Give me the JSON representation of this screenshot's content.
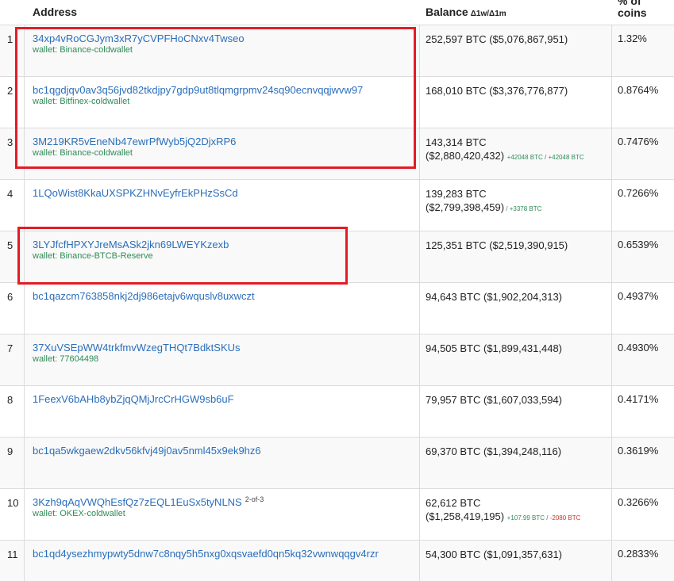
{
  "header": {
    "address": "Address",
    "balance": "Balance",
    "balance_sub": "Δ1w/Δ1m",
    "pct_line1": "% of",
    "pct_line2": "coins"
  },
  "rows": [
    {
      "rank": "1",
      "address": "34xp4vRoCGJym3xR7yCVPFHoCNxv4Twseo",
      "wallet": "wallet: Binance-coldwallet",
      "balance": "252,597 BTC ($5,076,867,951)",
      "pct": "1.32%"
    },
    {
      "rank": "2",
      "address": "bc1qgdjqv0av3q56jvd82tkdjpy7gdp9ut8tlqmgrpmv24sq90ecnvqqjwvw97",
      "wallet": "wallet: Bitfinex-coldwallet",
      "balance": "168,010 BTC ($3,376,776,877)",
      "pct": "0.8764%"
    },
    {
      "rank": "3",
      "address": "3M219KR5vEneNb47ewrPfWyb5jQ2DjxRP6",
      "wallet": "wallet: Binance-coldwallet",
      "balance_line1": "143,314 BTC",
      "balance_line2": "($2,880,420,432)",
      "delta1": "+42048 BTC",
      "delta_sep": " / ",
      "delta2": "+42048 BTC",
      "pct": "0.7476%"
    },
    {
      "rank": "4",
      "address": "1LQoWist8KkaUXSPKZHNvEyfrEkPHzSsCd",
      "balance_line1": "139,283 BTC",
      "balance_line2": "($2,799,398,459)",
      "delta_sep": " / ",
      "delta2": "+3378 BTC",
      "pct": "0.7266%"
    },
    {
      "rank": "5",
      "address": "3LYJfcfHPXYJreMsASk2jkn69LWEYKzexb",
      "wallet": "wallet: Binance-BTCB-Reserve",
      "balance": "125,351 BTC ($2,519,390,915)",
      "pct": "0.6539%"
    },
    {
      "rank": "6",
      "address": "bc1qazcm763858nkj2dj986etajv6wquslv8uxwczt",
      "balance": "94,643 BTC ($1,902,204,313)",
      "pct": "0.4937%"
    },
    {
      "rank": "7",
      "address": "37XuVSEpWW4trkfmvWzegTHQt7BdktSKUs",
      "wallet": "wallet: 77604498",
      "balance": "94,505 BTC ($1,899,431,448)",
      "pct": "0.4930%"
    },
    {
      "rank": "8",
      "address": "1FeexV6bAHb8ybZjqQMjJrcCrHGW9sb6uF",
      "balance": "79,957 BTC ($1,607,033,594)",
      "pct": "0.4171%"
    },
    {
      "rank": "9",
      "address": "bc1qa5wkgaew2dkv56kfvj49j0av5nml45x9ek9hz6",
      "balance": "69,370 BTC ($1,394,248,116)",
      "pct": "0.3619%"
    },
    {
      "rank": "10",
      "address": "3Kzh9qAqVWQhEsfQz7zEQL1EuSx5tyNLNS",
      "sup": "2-of-3",
      "wallet": "wallet: OKEX-coldwallet",
      "balance_line1": "62,612 BTC",
      "balance_line2": "($1,258,419,195)",
      "delta1": "+107.99 BTC",
      "delta_sep": " / ",
      "delta2": "-2080 BTC",
      "pct": "0.3266%"
    },
    {
      "rank": "11",
      "address": "bc1qd4ysezhmypwty5dnw7c8nqy5h5nxg0xqsvaefd0qn5kq32vwnwqqgv4rzr",
      "balance": "54,300 BTC ($1,091,357,631)",
      "pct": "0.2833%"
    }
  ],
  "colors": {
    "link": "#2a6ebb",
    "wallet": "#2e8b57",
    "highlight": "#e31c25",
    "negative": "#c0392b"
  }
}
